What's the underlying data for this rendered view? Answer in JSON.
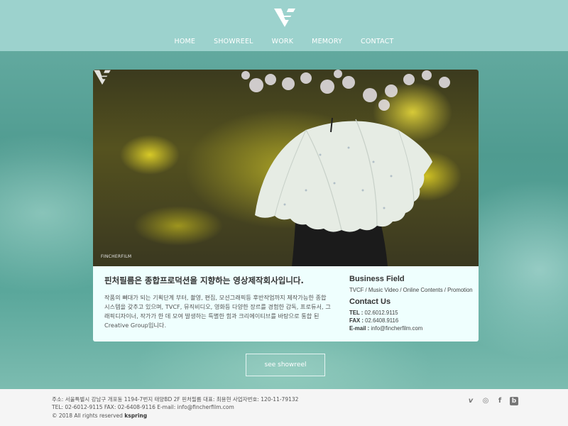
{
  "nav": {
    "items": [
      "HOME",
      "SHOWREEL",
      "WORK",
      "MEMORY",
      "CONTACT"
    ]
  },
  "hero": {
    "watermark": "FINCHERFILM"
  },
  "intro": {
    "headline": "핀처필름은 종합프로덕션을 지향하는 영상제작회사입니다.",
    "description": "작품의 뼈대가 되는 기획단계 부터, 촬영, 편집, 모션그래픽등 후반작업까지 제작가능한 종합 시스템을 갖추고 있으며, TVCF, 뮤직비디오, 영화등 다양한 장르를 경험한 감독, 프로듀서, 그래픽디자이너, 작가가 한 데 모여 발생하는 특별한 힘과 크리에이티브를 바탕으로 통합 된 Creative Group입니다."
  },
  "business": {
    "title": "Business Field",
    "fields": "TVCF / Music Video / Online Contents / Promotion"
  },
  "contact": {
    "title": "Contact Us",
    "tel_label": "TEL :",
    "tel": "02.6012.9115",
    "fax_label": "FAX :",
    "fax": "02.6408.9116",
    "email_label": "E-mail :",
    "email": "info@fincherfilm.com"
  },
  "showreel_button": "see showreel",
  "footer": {
    "address": "주소: 서울특별시 강남구 개포동 1194-7번지 태양BD 2F 핀처필름   대표: 최용현   사업자번호: 120-11-79132",
    "phones": "TEL: 02-6012-9115   FAX: 02-6408-9116   E-mail: info@fincherfilm.com",
    "copyright_prefix": "© 2018 All rights reserved",
    "copyright_brand": "kspring"
  },
  "social": {
    "icons": [
      "vimeo-icon",
      "instagram-icon",
      "facebook-icon",
      "blogger-icon"
    ],
    "glyphs": [
      "v",
      "◎",
      "f",
      "b"
    ]
  },
  "colors": {
    "header_bg": "#9cd2cd",
    "card_bg": "#effffe",
    "footer_bg": "#f5f5f5"
  }
}
